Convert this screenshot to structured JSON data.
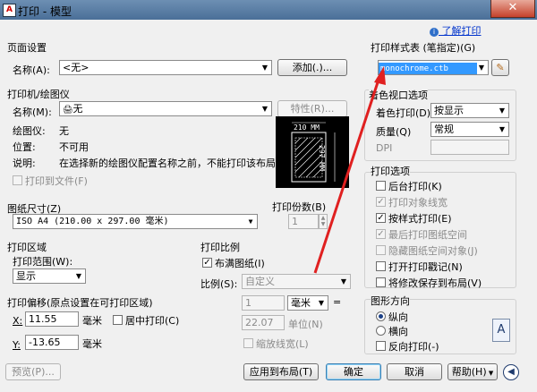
{
  "window": {
    "title": "打印 - 模型",
    "close_glyph": "✕",
    "help_link": "了解打印"
  },
  "page_setup": {
    "title": "页面设置",
    "name_label": "名称(A):",
    "name_value": "<无>",
    "add_button": "添加(.)..."
  },
  "printer": {
    "title": "打印机/绘图仪",
    "name_label": "名称(M):",
    "name_value": "无",
    "properties_button": "特性(R)...",
    "plotter_label": "绘图仪:",
    "plotter_value": "无",
    "location_label": "位置:",
    "location_value": "不可用",
    "desc_label": "说明:",
    "desc_value": "在选择新的绘图仪配置名称之前，不能打印该布局。",
    "print_to_file": "打印到文件(F)",
    "preview_width": "210 MM",
    "preview_height": "297 MM"
  },
  "paper_size": {
    "title": "图纸尺寸(Z)",
    "value": "ISO A4 (210.00 x 297.00 毫米)"
  },
  "copies": {
    "title": "打印份数(B)",
    "value": "1"
  },
  "plot_area": {
    "title": "打印区域",
    "range_label": "打印范围(W):",
    "range_value": "显示"
  },
  "plot_scale": {
    "title": "打印比例",
    "fit_paper": "布满图纸(I)",
    "scale_label": "比例(S):",
    "scale_value": "自定义",
    "value1": "1",
    "unit1": "毫米",
    "equals": "=",
    "value2": "22.07",
    "unit2": "单位(N)",
    "scale_lineweights": "缩放线宽(L)"
  },
  "plot_offset": {
    "title": "打印偏移(原点设置在可打印区域)",
    "x_label": "X:",
    "x_value": "11.55",
    "x_unit": "毫米",
    "center": "居中打印(C)",
    "y_label": "Y:",
    "y_value": "-13.65",
    "y_unit": "毫米"
  },
  "plot_style": {
    "title": "打印样式表 (笔指定)(G)",
    "value": "monochrome.ctb"
  },
  "shaded": {
    "title": "着色视口选项",
    "shade_label": "着色打印(D)",
    "shade_value": "按显示",
    "quality_label": "质量(Q)",
    "quality_value": "常规",
    "dpi_label": "DPI"
  },
  "options": {
    "title": "打印选项",
    "items": [
      {
        "label": "后台打印(K)",
        "checked": false,
        "disabled": false
      },
      {
        "label": "打印对象线宽",
        "checked": true,
        "disabled": true
      },
      {
        "label": "按样式打印(E)",
        "checked": true,
        "disabled": false
      },
      {
        "label": "最后打印图纸空间",
        "checked": true,
        "disabled": true
      },
      {
        "label": "隐藏图纸空间对象(J)",
        "checked": false,
        "disabled": true
      },
      {
        "label": "打开打印戳记(N)",
        "checked": false,
        "disabled": false
      },
      {
        "label": "将修改保存到布局(V)",
        "checked": false,
        "disabled": false
      }
    ]
  },
  "orientation": {
    "title": "图形方向",
    "portrait": "纵向",
    "landscape": "横向",
    "reverse": "反向打印(-)",
    "icon_letter": "A"
  },
  "buttons": {
    "preview": "预览(P)...",
    "apply": "应用到布局(T)",
    "ok": "确定",
    "cancel": "取消",
    "help": "帮助(H)"
  },
  "colors": {
    "highlight": "#3399ff",
    "arrow": "#e02020"
  }
}
